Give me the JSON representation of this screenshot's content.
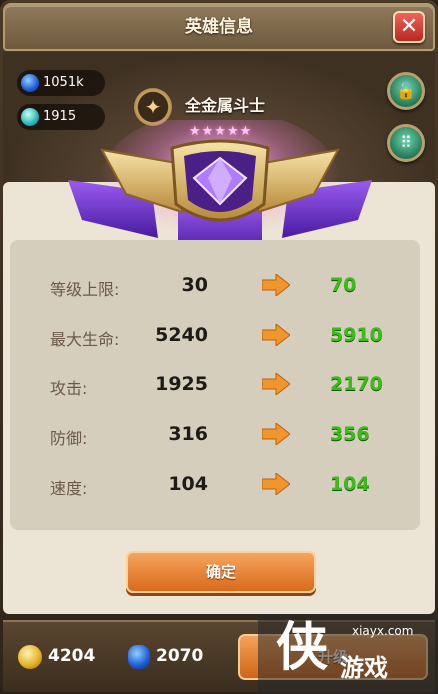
{
  "header": {
    "title": "英雄信息",
    "close_icon": "close-icon",
    "close_label": "✕"
  },
  "resources_top": [
    {
      "icon": "blue-gem-icon",
      "value": "1051k"
    },
    {
      "icon": "teal-crystal-icon",
      "value": "1915"
    }
  ],
  "hero": {
    "name": "全金属斗士",
    "stars": "★★★★★",
    "star_count": 5,
    "emblem_glyph": "✦",
    "rank_badge": "purple-gem-wing-badge"
  },
  "side_buttons": [
    {
      "icon": "lock-icon",
      "glyph": "🔓"
    },
    {
      "icon": "share-icon",
      "glyph": "⠿"
    }
  ],
  "stats": [
    {
      "label": "等级上限:",
      "old": "30",
      "new": "70"
    },
    {
      "label": "最大生命:",
      "old": "5240",
      "new": "5910"
    },
    {
      "label": "攻击:",
      "old": "1925",
      "new": "2170"
    },
    {
      "label": "防御:",
      "old": "316",
      "new": "356"
    },
    {
      "label": "速度:",
      "old": "104",
      "new": "104"
    }
  ],
  "confirm_label": "确定",
  "bottom": {
    "gold": "4204",
    "gems": "2070",
    "upgrade_label": "升级"
  },
  "watermark": {
    "site": "xiayx.com",
    "char": "侠",
    "text": "游戏"
  },
  "colors": {
    "new_value": "#3dbb18",
    "accent_orange": "#e0782a",
    "badge_purple": "#6a2fc8"
  }
}
